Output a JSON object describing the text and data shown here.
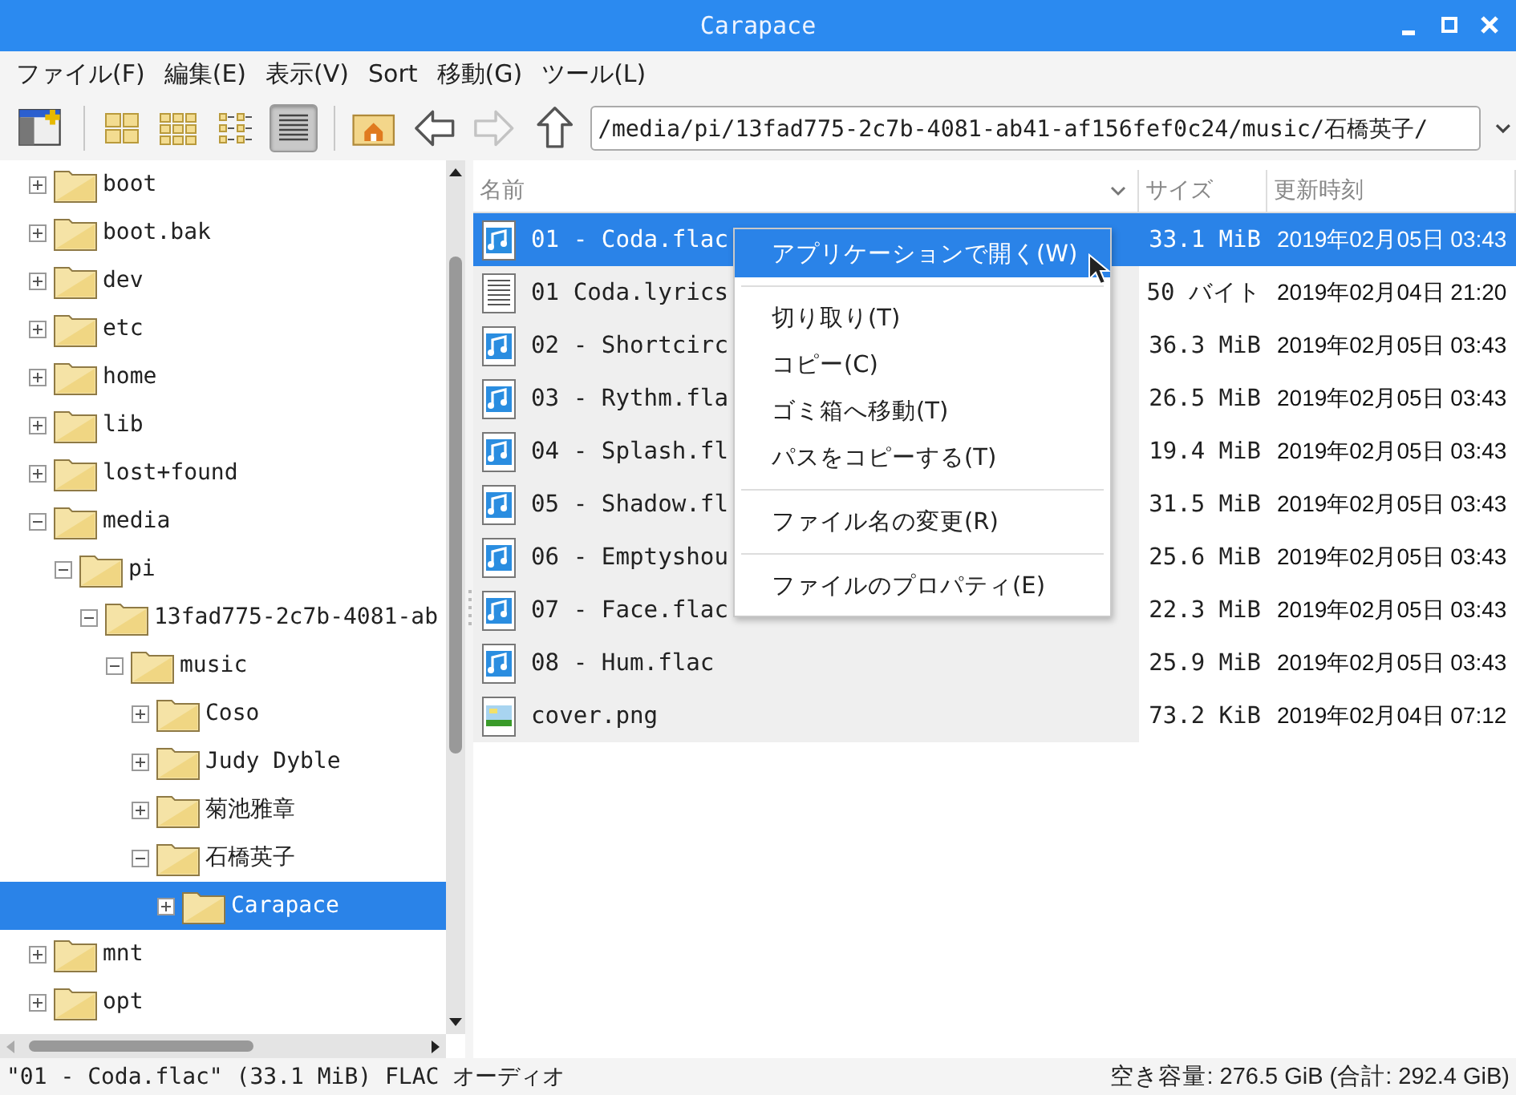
{
  "window": {
    "title": "Carapace"
  },
  "menu_bar": [
    "ファイル(F)",
    "編集(E)",
    "表示(V)",
    "Sort",
    "移動(G)",
    "ツール(L)"
  ],
  "toolbar": {
    "views": [
      {
        "kind": "icons",
        "selected": false
      },
      {
        "kind": "thumbnails",
        "selected": false
      },
      {
        "kind": "compact",
        "selected": false
      },
      {
        "kind": "detailed",
        "selected": true
      }
    ],
    "nav": [
      {
        "kind": "home",
        "disabled": false
      },
      {
        "kind": "back",
        "disabled": false
      },
      {
        "kind": "forward",
        "disabled": true
      },
      {
        "kind": "up",
        "disabled": false
      }
    ],
    "path": "/media/pi/13fad775-2c7b-4081-ab41-af156fef0c24/music/石橋英子/"
  },
  "tree": [
    {
      "name": "boot",
      "expanded": false,
      "selected": false
    },
    {
      "name": "boot.bak",
      "expanded": false,
      "selected": false
    },
    {
      "name": "dev",
      "expanded": false,
      "selected": false
    },
    {
      "name": "etc",
      "expanded": false,
      "selected": false
    },
    {
      "name": "home",
      "expanded": false,
      "selected": false
    },
    {
      "name": "lib",
      "expanded": false,
      "selected": false
    },
    {
      "name": "lost+found",
      "expanded": false,
      "selected": false
    },
    {
      "name": "media",
      "expanded": true,
      "selected": false,
      "children": [
        {
          "name": "pi",
          "expanded": true,
          "selected": false,
          "children": [
            {
              "name": "13fad775-2c7b-4081-ab",
              "expanded": true,
              "selected": false,
              "children": [
                {
                  "name": "music",
                  "expanded": true,
                  "selected": false,
                  "children": [
                    {
                      "name": "Coso",
                      "expanded": false,
                      "selected": false
                    },
                    {
                      "name": "Judy Dyble",
                      "expanded": false,
                      "selected": false
                    },
                    {
                      "name": "菊池雅章",
                      "expanded": false,
                      "selected": false
                    },
                    {
                      "name": "石橋英子",
                      "expanded": true,
                      "selected": false,
                      "children": [
                        {
                          "name": "Carapace",
                          "expanded": false,
                          "selected": true
                        }
                      ]
                    }
                  ]
                }
              ]
            }
          ]
        }
      ]
    },
    {
      "name": "mnt",
      "expanded": false,
      "selected": false
    },
    {
      "name": "opt",
      "expanded": false,
      "selected": false
    }
  ],
  "files": {
    "columns": [
      "名前",
      "サイズ",
      "更新時刻"
    ],
    "rows": [
      {
        "kind": "audio",
        "name": "01 - Coda.flac",
        "size": "33.1 MiB",
        "modified": "2019年02月05日 03:43",
        "selected": true
      },
      {
        "kind": "text",
        "name": "01 Coda.lyrics",
        "size": "50 バイト",
        "modified": "2019年02月04日 21:20",
        "selected": false
      },
      {
        "kind": "audio",
        "name": "02 - Shortcirc",
        "size": "36.3 MiB",
        "modified": "2019年02月05日 03:43",
        "selected": false
      },
      {
        "kind": "audio",
        "name": "03 - Rythm.fla",
        "size": "26.5 MiB",
        "modified": "2019年02月05日 03:43",
        "selected": false
      },
      {
        "kind": "audio",
        "name": "04 - Splash.fl",
        "size": "19.4 MiB",
        "modified": "2019年02月05日 03:43",
        "selected": false
      },
      {
        "kind": "audio",
        "name": "05 - Shadow.fl",
        "size": "31.5 MiB",
        "modified": "2019年02月05日 03:43",
        "selected": false
      },
      {
        "kind": "audio",
        "name": "06 - Emptyshou",
        "size": "25.6 MiB",
        "modified": "2019年02月05日 03:43",
        "selected": false
      },
      {
        "kind": "audio",
        "name": "07 - Face.flac",
        "size": "22.3 MiB",
        "modified": "2019年02月05日 03:43",
        "selected": false
      },
      {
        "kind": "audio",
        "name": "08 - Hum.flac",
        "size": "25.9 MiB",
        "modified": "2019年02月05日 03:43",
        "selected": false
      },
      {
        "kind": "image",
        "name": "cover.png",
        "size": "73.2 KiB",
        "modified": "2019年02月04日 07:12",
        "selected": false
      }
    ]
  },
  "context_menu": [
    {
      "kind": "item",
      "label": "アプリケーションで開く(W)",
      "selected": true
    },
    {
      "kind": "separator"
    },
    {
      "kind": "item",
      "label": "切り取り(T)",
      "selected": false
    },
    {
      "kind": "item",
      "label": "コピー(C)",
      "selected": false
    },
    {
      "kind": "item",
      "label": "ゴミ箱へ移動(T)",
      "selected": false
    },
    {
      "kind": "item",
      "label": "パスをコピーする(T)",
      "selected": false
    },
    {
      "kind": "separator"
    },
    {
      "kind": "item",
      "label": "ファイル名の変更(R)",
      "selected": false
    },
    {
      "kind": "separator"
    },
    {
      "kind": "item",
      "label": "ファイルのプロパティ(E)",
      "selected": false
    }
  ],
  "status_bar": {
    "left": "\"01 - Coda.flac\" (33.1 MiB) FLAC オーディオ",
    "right": "空き容量: 276.5 GiB (合計: 292.4 GiB)"
  }
}
